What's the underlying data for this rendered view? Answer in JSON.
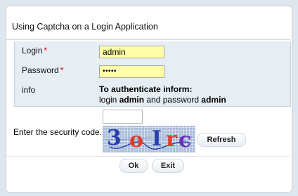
{
  "panel": {
    "title": "Using Captcha on a Login Application"
  },
  "form": {
    "login_label": "Login",
    "login_value": "admin",
    "password_label": "Password",
    "password_value": "•••••",
    "required_mark": "*",
    "info_label": "info",
    "info_title": "To authenticate inform:",
    "info_prefix": "login ",
    "info_user": "admin",
    "info_middle": " and password ",
    "info_pass": "admin"
  },
  "captcha": {
    "label": "Enter the security code.",
    "input_value": "",
    "chars": [
      "3",
      "o",
      "I",
      "r",
      "c"
    ],
    "refresh_label": "Refresh"
  },
  "actions": {
    "ok_label": "Ok",
    "exit_label": "Exit"
  },
  "colors": {
    "page_bg": "#dfe7ee",
    "form_bg": "#e6edf3",
    "input_bg": "#ffffa8",
    "required": "#dd0000",
    "captcha_bg": "#a7bcd9"
  }
}
